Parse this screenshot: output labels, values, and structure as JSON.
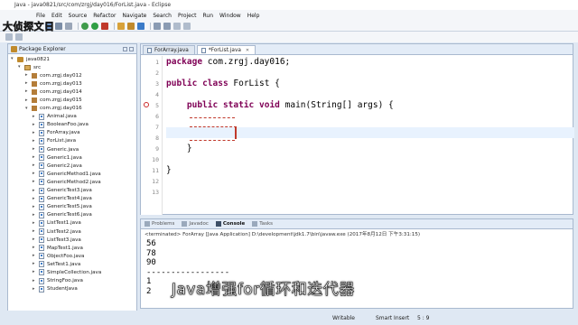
{
  "window": {
    "title": "Java - java0821/src/com/zrgj/day016/ForList.java - Eclipse"
  },
  "watermark": "大侦探文日",
  "menu": [
    "File",
    "Edit",
    "Source",
    "Refactor",
    "Navigate",
    "Search",
    "Project",
    "Run",
    "Window",
    "Help"
  ],
  "package_explorer": {
    "title": "Package Explorer",
    "tree": [
      {
        "label": "java0821",
        "level": 0,
        "icon": "project-icon",
        "twisty": "▾"
      },
      {
        "label": "src",
        "level": 1,
        "icon": "source-folder-icon",
        "twisty": "▾"
      },
      {
        "label": "com.zrgj.day012",
        "level": 2,
        "icon": "package-icon",
        "twisty": "▸"
      },
      {
        "label": "com.zrgj.day013",
        "level": 2,
        "icon": "package-icon",
        "twisty": "▸"
      },
      {
        "label": "com.zrgj.day014",
        "level": 2,
        "icon": "package-icon",
        "twisty": "▸"
      },
      {
        "label": "com.zrgj.day015",
        "level": 2,
        "icon": "package-icon",
        "twisty": "▸"
      },
      {
        "label": "com.zrgj.day016",
        "level": 2,
        "icon": "package-icon",
        "twisty": "▾"
      },
      {
        "label": "Animal.java",
        "level": 3,
        "icon": "java-file-icon",
        "twisty": "▸"
      },
      {
        "label": "BooleanFoo.java",
        "level": 3,
        "icon": "java-file-icon",
        "twisty": "▸"
      },
      {
        "label": "ForArray.java",
        "level": 3,
        "icon": "java-file-icon",
        "twisty": "▸"
      },
      {
        "label": "ForList.java",
        "level": 3,
        "icon": "java-file-icon",
        "twisty": "▸"
      },
      {
        "label": "Generic.java",
        "level": 3,
        "icon": "java-file-icon",
        "twisty": "▸"
      },
      {
        "label": "Generic1.java",
        "level": 3,
        "icon": "java-file-icon",
        "twisty": "▸"
      },
      {
        "label": "Generic2.java",
        "level": 3,
        "icon": "java-file-icon",
        "twisty": "▸"
      },
      {
        "label": "GenericMethod1.java",
        "level": 3,
        "icon": "java-file-icon",
        "twisty": "▸"
      },
      {
        "label": "GenericMethod2.java",
        "level": 3,
        "icon": "java-file-icon",
        "twisty": "▸"
      },
      {
        "label": "GenericTest3.java",
        "level": 3,
        "icon": "java-file-icon",
        "twisty": "▸"
      },
      {
        "label": "GenericTest4.java",
        "level": 3,
        "icon": "java-file-icon",
        "twisty": "▸"
      },
      {
        "label": "GenericTest5.java",
        "level": 3,
        "icon": "java-file-icon",
        "twisty": "▸"
      },
      {
        "label": "GenericTest6.java",
        "level": 3,
        "icon": "java-file-icon",
        "twisty": "▸"
      },
      {
        "label": "ListTest1.java",
        "level": 3,
        "icon": "java-file-icon",
        "twisty": "▸"
      },
      {
        "label": "ListTest2.java",
        "level": 3,
        "icon": "java-file-icon",
        "twisty": "▸"
      },
      {
        "label": "ListTest3.java",
        "level": 3,
        "icon": "java-file-icon",
        "twisty": "▸"
      },
      {
        "label": "MapTest1.java",
        "level": 3,
        "icon": "java-file-icon",
        "twisty": "▸"
      },
      {
        "label": "ObjectFoo.java",
        "level": 3,
        "icon": "java-file-icon",
        "twisty": "▸"
      },
      {
        "label": "SetTest1.java",
        "level": 3,
        "icon": "java-file-icon",
        "twisty": "▸"
      },
      {
        "label": "SimpleCollection.java",
        "level": 3,
        "icon": "java-file-icon",
        "twisty": "▸"
      },
      {
        "label": "StringFoo.java",
        "level": 3,
        "icon": "java-file-icon",
        "twisty": "▸"
      },
      {
        "label": "StudentJava",
        "level": 3,
        "icon": "java-file-icon",
        "twisty": "▸"
      }
    ]
  },
  "editor": {
    "tabs": [
      {
        "label": "ForArray.java",
        "active": false
      },
      {
        "label": "*ForList.java",
        "active": true
      }
    ],
    "line_numbers": [
      "1",
      "2",
      "3",
      "4",
      "5",
      "6",
      "7",
      "8",
      "9",
      "10",
      "11",
      "12",
      "13"
    ],
    "lines": [
      {
        "n": 1,
        "parts": [
          {
            "t": "package",
            "kw": true
          },
          {
            "t": " com.zrgj.day016;"
          }
        ]
      },
      {
        "n": 3,
        "parts": [
          {
            "t": "public",
            "kw": true
          },
          {
            "t": " "
          },
          {
            "t": "class",
            "kw": true
          },
          {
            "t": " ForList {"
          }
        ]
      },
      {
        "n": 5,
        "parts": [
          {
            "t": "    "
          },
          {
            "t": "public",
            "kw": true
          },
          {
            "t": " "
          },
          {
            "t": "static",
            "kw": true
          },
          {
            "t": " "
          },
          {
            "t": "void",
            "kw": true
          },
          {
            "t": " main(String[] args) {"
          }
        ]
      },
      {
        "n": 9,
        "parts": [
          {
            "t": "    }"
          }
        ]
      },
      {
        "n": 11,
        "parts": [
          {
            "t": "}"
          }
        ]
      }
    ]
  },
  "console": {
    "tabs": [
      "Problems",
      "Javadoc",
      "Console",
      "Tasks"
    ],
    "active_tab": "Console",
    "header": "<terminated> ForArray [Java Application] D:\\development\\jdk1.7\\bin\\javaw.exe (2017年8月12日 下午3:31:15)",
    "output": [
      "56",
      "78",
      "90",
      "-----------------",
      "1",
      "2"
    ]
  },
  "status": {
    "writable": "Writable",
    "insert_mode": "Smart Insert",
    "position": "5 : 9"
  },
  "subtitle": "Java增强for循环和迭代器",
  "colors": {
    "keyword": "#7f0055",
    "current_line": "#e8f2fe",
    "panel_border": "#a9b9cf",
    "chrome": "#dfe8f3"
  }
}
